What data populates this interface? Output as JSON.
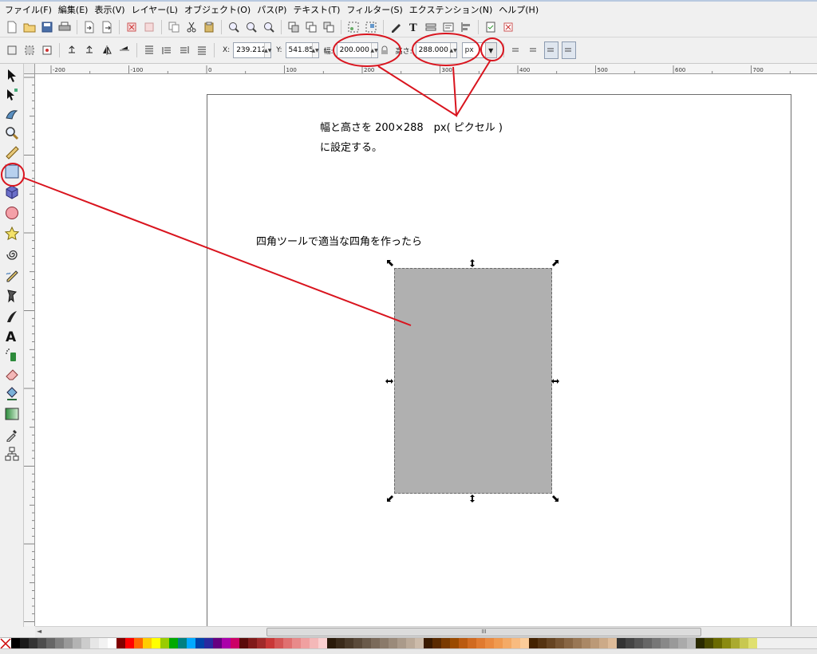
{
  "menubar": {
    "items": [
      "ファイル(F)",
      "編集(E)",
      "表示(V)",
      "レイヤー(L)",
      "オブジェクト(O)",
      "パス(P)",
      "テキスト(T)",
      "フィルター(S)",
      "エクステンション(N)",
      "ヘルプ(H)"
    ]
  },
  "controls": {
    "x_label": "X:",
    "x_value": "239.212",
    "y_label": "Y:",
    "y_value": "541.855",
    "w_label": "幅:",
    "w_value": "200.000",
    "h_label": "高さ:",
    "h_value": "288.000",
    "unit": "px"
  },
  "canvas": {
    "note_size_line1": "幅と高さを 200×288　px( ピクセル )",
    "note_size_line2": "に設定する。",
    "note_tool": "四角ツールで適当な四角を作ったら"
  },
  "ruler": {
    "top_labels": [
      "-200",
      "-100",
      "0",
      "100",
      "200",
      "300",
      "400",
      "500",
      "600",
      "700"
    ]
  },
  "scroll": {
    "thumb_label": "III"
  },
  "colors": {
    "annotation_red": "#d9141e",
    "rect_fill": "#b0b0b0"
  },
  "icons": {
    "tools": [
      "select-arrow-icon",
      "node-edit-icon",
      "tweak-icon",
      "zoom-icon",
      "measure-icon",
      "rectangle-icon",
      "box3d-icon",
      "ellipse-icon",
      "star-icon",
      "spiral-icon",
      "pencil-icon",
      "pen-icon",
      "calligraphy-icon",
      "text-icon",
      "spray-icon",
      "eraser-icon",
      "paint-bucket-icon",
      "gradient-icon",
      "dropper-icon",
      "connector-icon"
    ]
  }
}
